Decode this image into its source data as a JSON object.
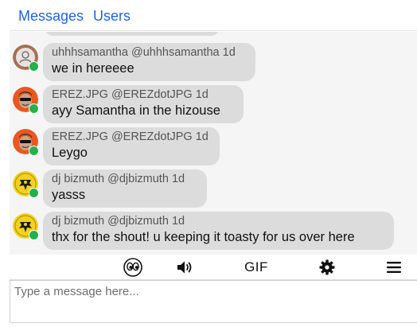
{
  "tabs": {
    "messages": "Messages",
    "users": "Users"
  },
  "messages": [
    {
      "display_name": "uhhhsamantha",
      "handle": "@uhhhsamantha",
      "time": "1d",
      "text": "we in hereeee",
      "avatar": "default-user-icon",
      "online": true
    },
    {
      "display_name": "EREZ.JPG",
      "handle": "@EREZdotJPG",
      "time": "1d",
      "text": "ayy Samantha in the hizouse",
      "avatar": "sunglasses-face-orange",
      "online": true
    },
    {
      "display_name": "EREZ.JPG",
      "handle": "@EREZdotJPG",
      "time": "1d",
      "text": "Leygo",
      "avatar": "sunglasses-face-orange",
      "online": true
    },
    {
      "display_name": "dj bizmuth",
      "handle": "@djbizmuth",
      "time": "1d",
      "text": "yasss",
      "avatar": "yellow-crest-icon",
      "online": true
    },
    {
      "display_name": "dj bizmuth",
      "handle": "@djbizmuth",
      "time": "1d",
      "text": "thx for the shout! u keeping it toasty for us over here",
      "avatar": "yellow-crest-icon",
      "online": true
    }
  ],
  "toolbar": {
    "emoji_icon": "eyes-emoji-icon",
    "sound_icon": "speaker-icon",
    "gif_label": "GIF",
    "settings_icon": "gear-icon",
    "menu_icon": "hamburger-menu-icon"
  },
  "composer": {
    "placeholder": "Type a message here...",
    "value": ""
  },
  "colors": {
    "accent": "#1f63e6",
    "bubble": "#dcdcdc",
    "online": "#22b14c",
    "feed_bg": "#f5f5f5"
  }
}
